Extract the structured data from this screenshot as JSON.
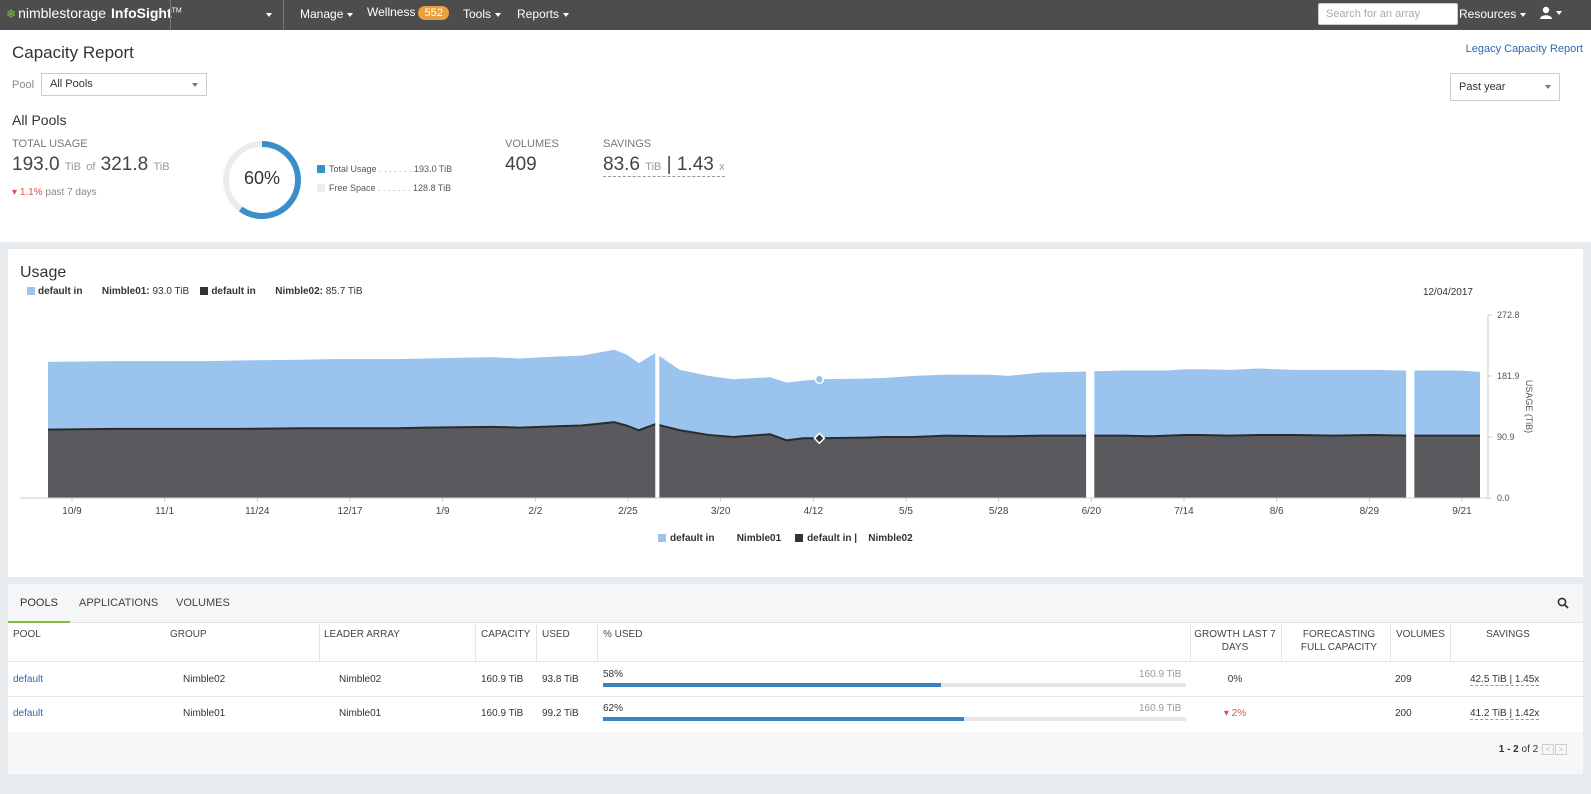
{
  "nav": {
    "brand1": "nimblestorage",
    "brand2": "InfoSight",
    "brand_tm": "TM",
    "manage": "Manage",
    "wellness": "Wellness",
    "wellness_count": "552",
    "tools": "Tools",
    "reports": "Reports",
    "search_placeholder": "Search for an array",
    "resources": "Resources"
  },
  "header": {
    "title": "Capacity Report",
    "legacy_link": "Legacy Capacity Report",
    "pool_label": "Pool",
    "pool_value": "All Pools",
    "range_value": "Past year",
    "subtitle": "All Pools",
    "total_usage_label": "TOTAL USAGE",
    "total_usage_value": "193.0",
    "total_usage_unit": "TiB",
    "of": "of",
    "total_capacity_value": "321.8",
    "total_capacity_unit": "TiB",
    "delta_value": "1.1%",
    "delta_period": "past 7 days",
    "donut_percent": "60%",
    "donut_fraction": 0.6,
    "legend_total_label": "Total Usage",
    "legend_total_value": "193.0 TiB",
    "legend_free_label": "Free Space",
    "legend_free_value": "128.8 TiB",
    "volumes_label": "VOLUMES",
    "volumes_value": "409",
    "savings_label": "SAVINGS",
    "savings_value": "83.6",
    "savings_unit": "TiB",
    "savings_sep": "|",
    "savings_ratio": "1.43",
    "savings_ratio_unit": "x"
  },
  "colors": {
    "nimble01": "#9ac4ed",
    "nimble02": "#5a5a5e",
    "donut": "#3a8fc9",
    "donut_track": "#ececec"
  },
  "usage": {
    "title": "Usage",
    "legend1_prefix": "default in",
    "legend1_name": "Nimble01:",
    "legend1_value": "93.0 TiB",
    "legend2_prefix": "default in",
    "legend2_name": "Nimble02:",
    "legend2_value": "85.7 TiB",
    "date": "12/04/2017",
    "bottom1_prefix": "default in",
    "bottom1_name": "Nimble01",
    "bottom2_prefix": "default in |",
    "bottom2_name": "Nimble02"
  },
  "chart_data": {
    "type": "area",
    "stacked": true,
    "ylabel": "USAGE (TiB)",
    "ylim": [
      0,
      272.8
    ],
    "yticks": [
      0.0,
      90.9,
      181.9,
      272.8
    ],
    "x_tick_labels": [
      "10/9",
      "11/1",
      "11/24",
      "12/17",
      "1/9",
      "2/2",
      "2/25",
      "3/20",
      "4/12",
      "5/5",
      "5/28",
      "6/20",
      "7/14",
      "8/6",
      "8/29",
      "9/21"
    ],
    "x": [
      0,
      16,
      23,
      39,
      46,
      62,
      69,
      85,
      92,
      108,
      115,
      124,
      130,
      138,
      141,
      144,
      148,
      154,
      161,
      167,
      176,
      180,
      184,
      188,
      199,
      204,
      211,
      219,
      229,
      234,
      242,
      250,
      262,
      269,
      273,
      277,
      281,
      288,
      295,
      304,
      313,
      323,
      331,
      340,
      344,
      349
    ],
    "series": [
      {
        "name": "default in Nimble02",
        "values": [
          102,
          103,
          103,
          103,
          103,
          104,
          104,
          104,
          105,
          106,
          105,
          107,
          108,
          113,
          108,
          101,
          110,
          101,
          94,
          91,
          95,
          86,
          89,
          89,
          90,
          91,
          91,
          93,
          92,
          92,
          93,
          93,
          93,
          92,
          93,
          94,
          94,
          93,
          94,
          94,
          93,
          94,
          93,
          93,
          93,
          93
        ]
      },
      {
        "name": "default in Nimble01",
        "values": [
          101,
          101,
          101,
          101,
          102,
          102,
          103,
          103,
          103,
          104,
          103,
          104,
          104,
          108,
          106,
          100,
          106,
          90,
          88,
          86,
          85,
          86,
          86,
          88,
          88,
          88,
          91,
          91,
          92,
          90,
          94,
          95,
          97,
          98,
          97,
          98,
          98,
          98,
          99,
          97,
          98,
          97,
          97,
          97,
          97,
          95
        ]
      }
    ],
    "gaps": [
      [
        148,
        149
      ],
      [
        253,
        255
      ],
      [
        331,
        333
      ]
    ]
  },
  "table": {
    "tabs": [
      "POOLS",
      "APPLICATIONS",
      "VOLUMES"
    ],
    "headers": [
      "POOL",
      "GROUP",
      "LEADER ARRAY",
      "CAPACITY",
      "USED",
      "% USED",
      "GROWTH LAST 7 DAYS",
      "FORECASTING FULL CAPACITY",
      "VOLUMES",
      "SAVINGS"
    ],
    "rows": [
      {
        "pool": "default",
        "group": "Nimble02",
        "leader": "Nimble02",
        "capacity": "160.9 TiB",
        "used": "93.8 TiB",
        "pct_label": "58%",
        "pct": 0.58,
        "bar_cap": "160.9 TiB",
        "growth": "0%",
        "growth_down": false,
        "forecast": "",
        "volumes": "209",
        "savings": "42.5 TiB | 1.45x"
      },
      {
        "pool": "default",
        "group": "Nimble01",
        "leader": "Nimble01",
        "capacity": "160.9 TiB",
        "used": "99.2 TiB",
        "pct_label": "62%",
        "pct": 0.62,
        "bar_cap": "160.9 TiB",
        "growth": "2%",
        "growth_down": true,
        "forecast": "",
        "volumes": "200",
        "savings": "41.2 TiB | 1.42x"
      }
    ],
    "pager_range": "1 - 2",
    "pager_of": "of 2"
  }
}
